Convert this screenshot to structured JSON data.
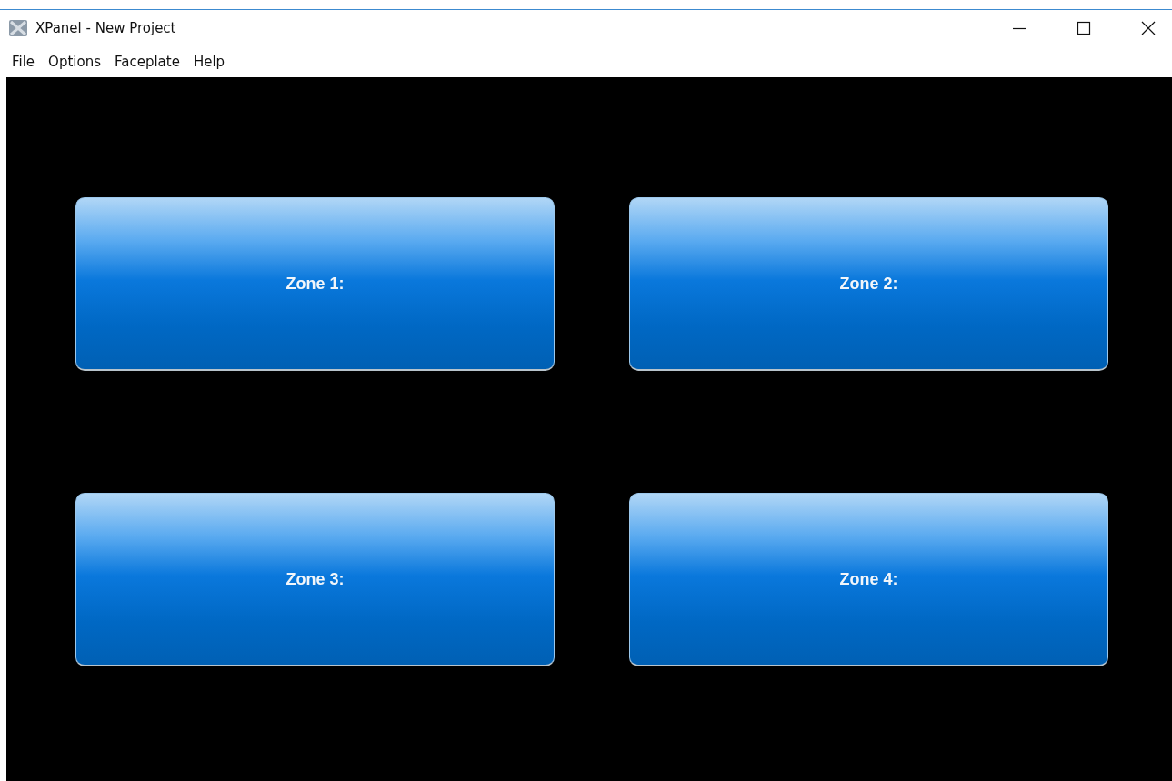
{
  "window": {
    "title": "XPanel - New Project"
  },
  "menu": [
    "File",
    "Options",
    "Faceplate",
    "Help"
  ],
  "zones": [
    {
      "label": "Zone 1:"
    },
    {
      "label": "Zone 2:"
    },
    {
      "label": "Zone 3:"
    },
    {
      "label": "Zone 4:"
    }
  ]
}
